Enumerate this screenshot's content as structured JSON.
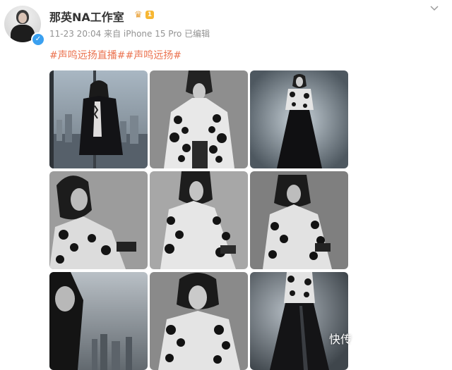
{
  "post": {
    "username": "那英NA工作室",
    "vip_level": "1",
    "meta": "11-23 20:04  来自 iPhone 15 Pro 已编辑",
    "hashtags": "#声鸣远扬直播##声鸣远扬#"
  },
  "watermark": "快传",
  "icons": {
    "avatar_verified": "verified-check-icon",
    "vip_badge": "crown-icon",
    "more": "chevron-down-icon"
  },
  "colors": {
    "hashtag": "#eb7350",
    "verified": "#3aa0f0",
    "vip": "#f7b733"
  },
  "photos": [
    {
      "name": "photo-1-city-window"
    },
    {
      "name": "photo-2-lace-blazer"
    },
    {
      "name": "photo-3-full-length-gown"
    },
    {
      "name": "photo-4-side-portrait"
    },
    {
      "name": "photo-5-lace-jacket-pose"
    },
    {
      "name": "photo-6-looking-down"
    },
    {
      "name": "photo-7-city-profile"
    },
    {
      "name": "photo-8-smiling-portrait"
    },
    {
      "name": "photo-9-satin-skirt"
    }
  ]
}
